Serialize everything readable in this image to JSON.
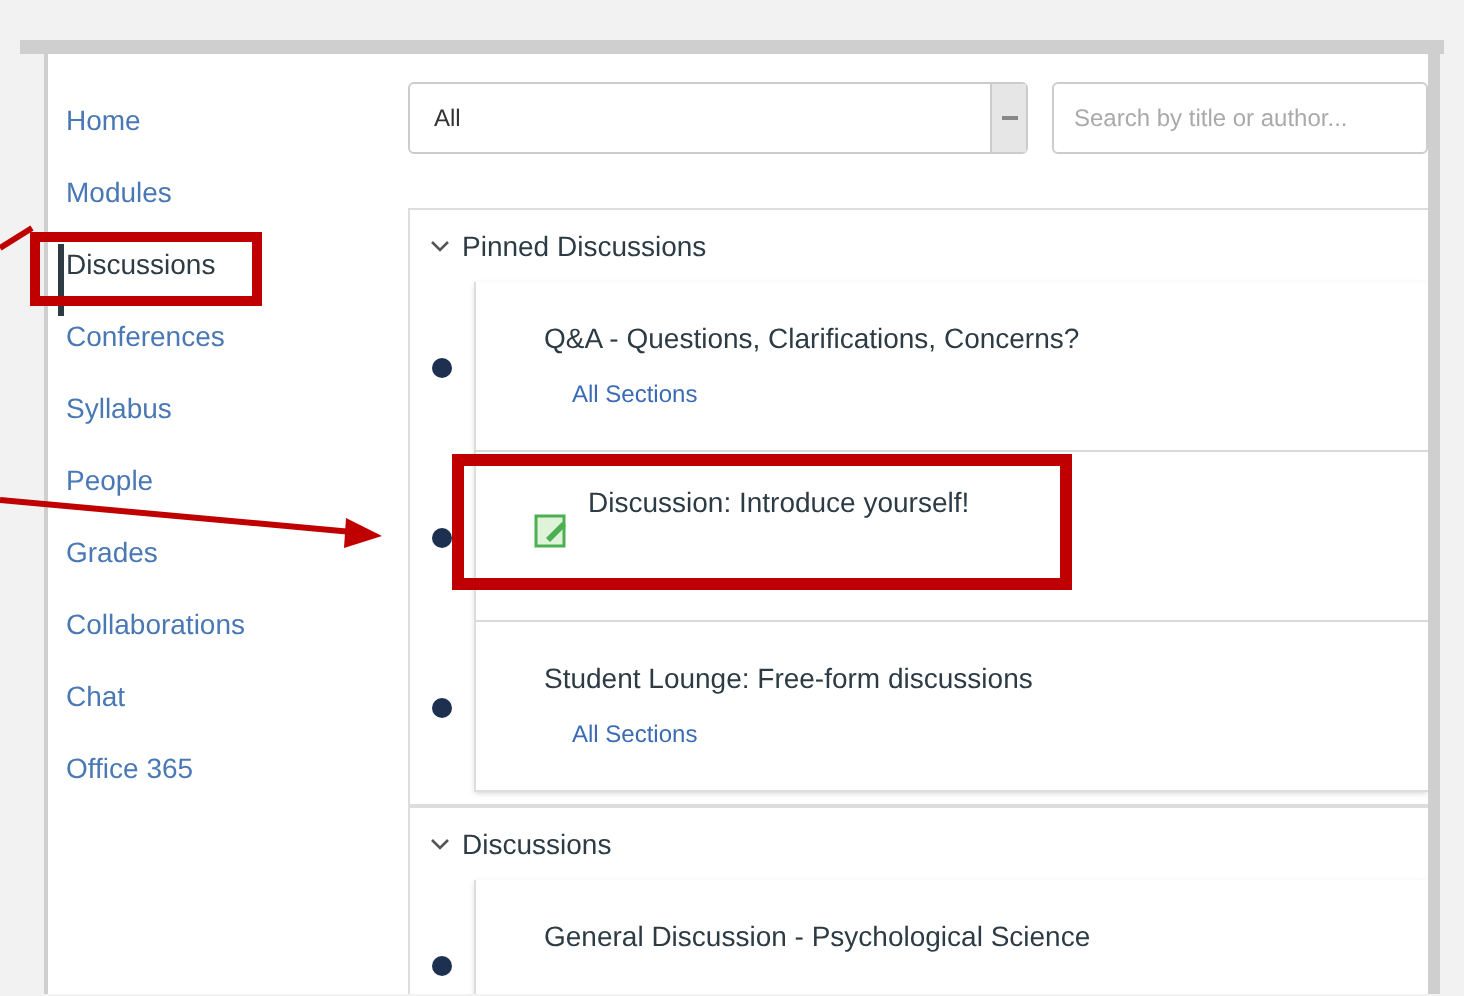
{
  "sidebar": {
    "items": [
      {
        "label": "Home",
        "selected": false
      },
      {
        "label": "Modules",
        "selected": false
      },
      {
        "label": "Discussions",
        "selected": true
      },
      {
        "label": "Conferences",
        "selected": false
      },
      {
        "label": "Syllabus",
        "selected": false
      },
      {
        "label": "People",
        "selected": false
      },
      {
        "label": "Grades",
        "selected": false
      },
      {
        "label": "Collaborations",
        "selected": false
      },
      {
        "label": "Chat",
        "selected": false
      },
      {
        "label": "Office 365",
        "selected": false
      }
    ]
  },
  "filter": {
    "value": "All"
  },
  "search": {
    "placeholder": "Search by title or author..."
  },
  "groups": [
    {
      "title": "Pinned Discussions",
      "expanded": true,
      "items": [
        {
          "title": "Q&A - Questions, Clarifications, Concerns?",
          "sections": "All Sections",
          "highlighted": false,
          "kind": "plain"
        },
        {
          "title": "Discussion: Introduce yourself!",
          "highlighted": true,
          "kind": "graded"
        },
        {
          "title": "Student Lounge: Free-form discussions",
          "sections": "All Sections",
          "highlighted": false,
          "kind": "plain"
        }
      ]
    },
    {
      "title": "Discussions",
      "expanded": true,
      "items": [
        {
          "title": "General Discussion - Psychological Science",
          "highlighted": false,
          "kind": "plain"
        }
      ]
    }
  ]
}
